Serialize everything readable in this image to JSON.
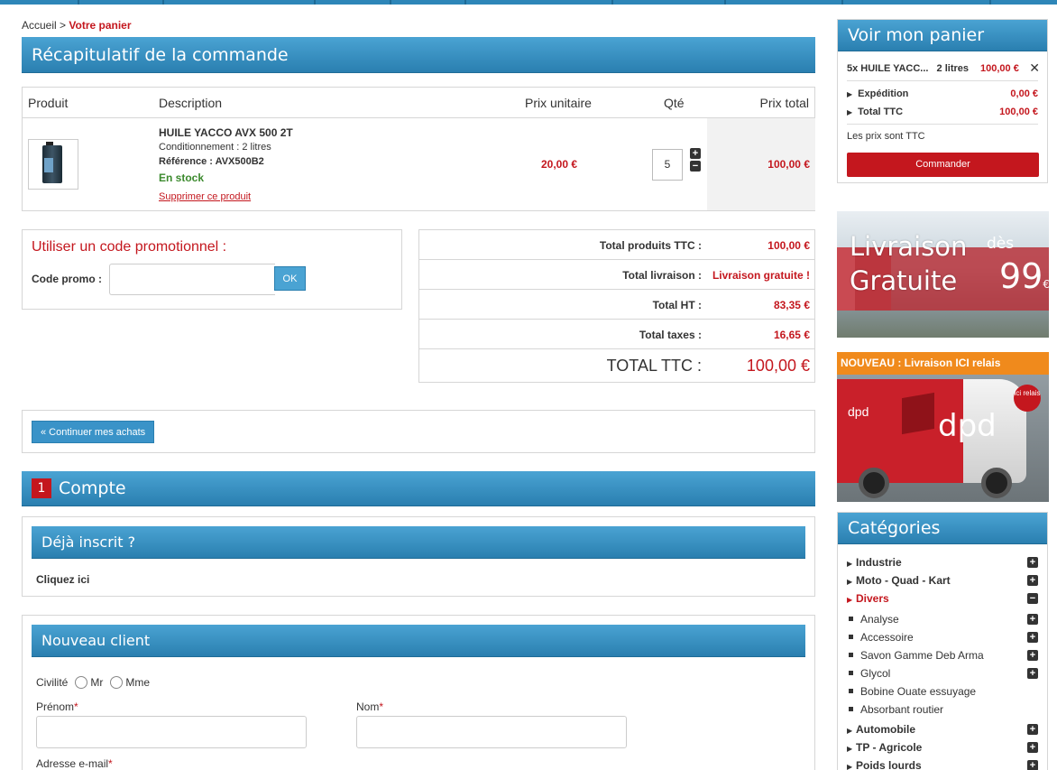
{
  "breadcrumb": {
    "home": "Accueil",
    "sep": ">",
    "current": "Votre panier"
  },
  "summary": {
    "title": "Récapitulatif de la commande",
    "columns": {
      "product": "Produit",
      "description": "Description",
      "unit_price": "Prix unitaire",
      "qty": "Qté",
      "total": "Prix total"
    },
    "item": {
      "name": "HUILE YACCO AVX 500 2T",
      "conditioning": "Conditionnement : 2 litres",
      "reference": "Référence : AVX500B2",
      "stock": "En stock",
      "delete": "Supprimer ce produit",
      "unit_price": "20,00 €",
      "qty": "5",
      "total": "100,00 €"
    }
  },
  "promo": {
    "title": "Utiliser un code promotionnel :",
    "label": "Code promo :",
    "value": "",
    "ok": "OK"
  },
  "totals": [
    {
      "label": "Total produits TTC :",
      "value": "100,00 €"
    },
    {
      "label": "Total livraison :",
      "value": "Livraison gratuite !"
    },
    {
      "label": "Total HT :",
      "value": "83,35 €"
    },
    {
      "label": "Total taxes :",
      "value": "16,65 €"
    },
    {
      "label": "TOTAL TTC :",
      "value": "100,00 €"
    }
  ],
  "continue_label": "« Continuer mes achats",
  "account": {
    "step": "1",
    "title": "Compte",
    "existing": {
      "title": "Déjà inscrit ?",
      "link": "Cliquez ici"
    },
    "new_client": {
      "title": "Nouveau client",
      "civility": "Civilité",
      "mr": "Mr",
      "mme": "Mme",
      "firstname": "Prénom",
      "lastname": "Nom",
      "email": "Adresse e-mail",
      "required_mark": "*"
    }
  },
  "mini_cart": {
    "title": "Voir mon panier",
    "item": "5x HUILE YACC...",
    "item_volume": "2 litres",
    "item_price": "100,00 €",
    "shipping_label": "Expédition",
    "shipping_value": "0,00 €",
    "total_label": "Total TTC",
    "total_value": "100,00 €",
    "note": "Les prix sont TTC",
    "order_button": "Commander"
  },
  "banner_delivery": {
    "line1": "Livraison",
    "line2": "Gratuite",
    "des": "dès",
    "amount": "99",
    "currency": "€"
  },
  "banner_relais": {
    "title": "NOUVEAU : Livraison ICI relais",
    "brand": "dpd",
    "badge": "ici relais"
  },
  "categories": {
    "title": "Catégories",
    "items": [
      {
        "label": "Industrie",
        "type": "main",
        "toggle": "+"
      },
      {
        "label": "Moto - Quad - Kart",
        "type": "main",
        "toggle": "+"
      },
      {
        "label": "Divers",
        "type": "main-active",
        "toggle": "−"
      },
      {
        "label": "Analyse",
        "type": "sub",
        "toggle": "+"
      },
      {
        "label": "Accessoire",
        "type": "sub",
        "toggle": "+"
      },
      {
        "label": "Savon Gamme Deb Arma",
        "type": "sub",
        "toggle": "+"
      },
      {
        "label": "Glycol",
        "type": "sub",
        "toggle": "+"
      },
      {
        "label": "Bobine Ouate essuyage",
        "type": "sub",
        "toggle": ""
      },
      {
        "label": "Absorbant routier",
        "type": "sub",
        "toggle": ""
      },
      {
        "label": "Automobile",
        "type": "main",
        "toggle": "+"
      },
      {
        "label": "TP - Agricole",
        "type": "main",
        "toggle": "+"
      },
      {
        "label": "Poids lourds",
        "type": "main",
        "toggle": "+"
      }
    ]
  },
  "colors": {
    "brand_blue": "#2a7fb0",
    "accent_red": "#c4171e",
    "stock_green": "#3c8a2e",
    "promo_orange": "#f08a1c"
  }
}
